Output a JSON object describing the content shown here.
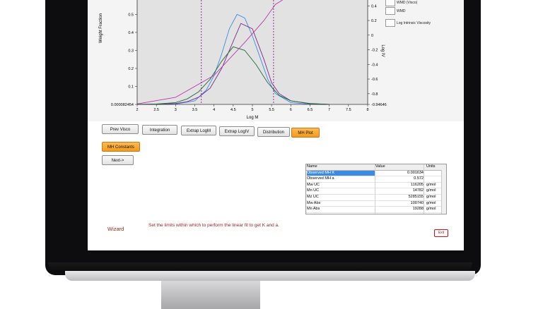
{
  "chart": {
    "xlabel": "Log M",
    "ylabel_left": "Weight Fraction",
    "ylabel_right": "Log IV",
    "x_ticks": [
      "2",
      "2.5",
      "3",
      "3.5",
      "4",
      "4.5",
      "5",
      "5.5",
      "6",
      "6.5",
      "7",
      "7.5",
      "8"
    ],
    "y_left_ticks": [
      "0.5",
      "0.4",
      "0.3",
      "0.2",
      "0.1",
      "0.000082454"
    ],
    "y_right_ticks": [
      "0.4",
      "0.2",
      "0",
      "-0.2",
      "-0.4",
      "-0.6",
      "-0.8",
      "-0.94646"
    ],
    "legend": [
      "WMD (Visco)",
      "WMD",
      "Log Intrinsic Viscosity"
    ],
    "colors": {
      "plot_bg": "#e2e2e2",
      "dashed_limits": "#8b1a8b",
      "blue": "#3a8de0",
      "green": "#1f6b3a",
      "purple": "#7b2a8c",
      "magenta": "#b63aa8"
    }
  },
  "chart_data": {
    "type": "line",
    "xlabel": "Log M",
    "ylabel": "Weight Fraction",
    "xlim": [
      2,
      8
    ],
    "series": [
      {
        "name": "WMD",
        "color": "#3a8de0",
        "x": [
          2.0,
          2.5,
          3.0,
          3.5,
          3.8,
          4.0,
          4.2,
          4.4,
          4.6,
          4.8,
          5.0,
          5.2,
          5.4,
          5.6,
          6.0,
          6.5,
          7.0
        ],
        "y": [
          0.0,
          0.0,
          0.002,
          0.02,
          0.08,
          0.16,
          0.28,
          0.42,
          0.5,
          0.48,
          0.38,
          0.26,
          0.14,
          0.06,
          0.01,
          0.001,
          0.0
        ]
      },
      {
        "name": "WMD (Visco)",
        "color": "#7b2a8c",
        "x": [
          2.0,
          2.5,
          3.0,
          3.3,
          3.6,
          3.9,
          4.2,
          4.5,
          4.7,
          5.0,
          5.3,
          5.5,
          5.7,
          6.0,
          6.5,
          7.0
        ],
        "y": [
          0.0,
          0.0,
          0.005,
          0.015,
          0.04,
          0.09,
          0.2,
          0.35,
          0.45,
          0.42,
          0.25,
          0.12,
          0.06,
          0.02,
          0.004,
          0.0
        ]
      },
      {
        "name": "",
        "color": "#1f6b3a",
        "x": [
          2.0,
          2.5,
          3.0,
          3.3,
          3.6,
          3.9,
          4.2,
          4.5,
          4.8,
          5.1,
          5.4,
          5.7,
          6.0,
          6.5,
          7.0
        ],
        "y": [
          0.0,
          0.002,
          0.01,
          0.03,
          0.07,
          0.14,
          0.24,
          0.32,
          0.3,
          0.22,
          0.12,
          0.05,
          0.02,
          0.005,
          0.0
        ]
      }
    ]
  },
  "buttons": [
    "Prev Visco",
    "Integration",
    "Extrap LogM",
    "Extrap LogIV",
    "Distribution",
    "MH Plot"
  ],
  "mh_constants": "MH Constants",
  "next": "Next->",
  "grid": {
    "headers": [
      "Name",
      "Value",
      "Units"
    ],
    "rows": [
      [
        "Observed MH K",
        "0.001634",
        ""
      ],
      [
        "Observed MH a",
        "0.572",
        ""
      ],
      [
        "Mw UC",
        "116205",
        "g/mol"
      ],
      [
        "Mn UC",
        "14782",
        "g/mol"
      ],
      [
        "Mz UC",
        "5285155",
        "g/mol"
      ],
      [
        "Mw Abs",
        "100740",
        "g/mol"
      ],
      [
        "Mn Abs",
        "19288",
        "g/mol"
      ]
    ]
  },
  "wizard": {
    "label": "Wizard",
    "message": "Set the limits within which to perform the linear fit to get K and a."
  },
  "exit": "Exit"
}
